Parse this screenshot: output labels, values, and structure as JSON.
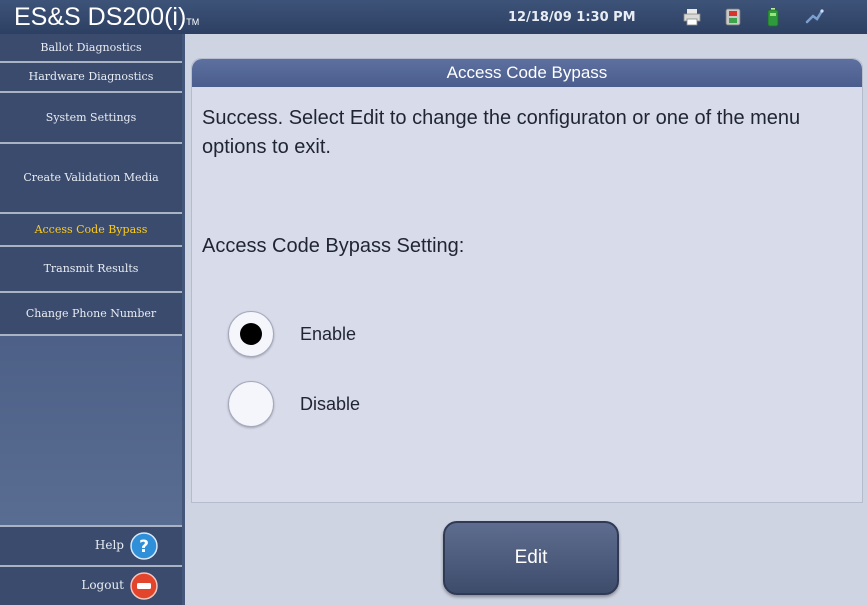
{
  "title_bar": {
    "app_title": "ES&S DS200(i)",
    "trademark": "TM",
    "datetime": "12/18/09 1:30 PM",
    "status_icons": [
      "printer-icon",
      "memory-card-icon",
      "battery-icon",
      "network-icon"
    ]
  },
  "sidebar": {
    "items": [
      {
        "label": "Ballot Diagnostics",
        "active": false
      },
      {
        "label": "Hardware Diagnostics",
        "active": false
      },
      {
        "label": "System Settings",
        "active": false
      },
      {
        "label": "Create Validation Media",
        "active": false
      },
      {
        "label": "Access Code Bypass",
        "active": true
      },
      {
        "label": "Transmit Results",
        "active": false
      },
      {
        "label": "Change Phone Number",
        "active": false
      }
    ],
    "help_label": "Help",
    "logout_label": "Logout"
  },
  "main": {
    "panel_title": "Access Code Bypass",
    "message": "Success. Select Edit to change the configuraton or one of the menu options to exit.",
    "setting_label": "Access Code Bypass Setting:",
    "options": [
      {
        "label": "Enable",
        "selected": true
      },
      {
        "label": "Disable",
        "selected": false
      }
    ],
    "edit_label": "Edit"
  },
  "colors": {
    "active_menu_text": "#ffcc1a",
    "help_icon": "#2f8fd8",
    "logout_icon": "#e2452b"
  }
}
